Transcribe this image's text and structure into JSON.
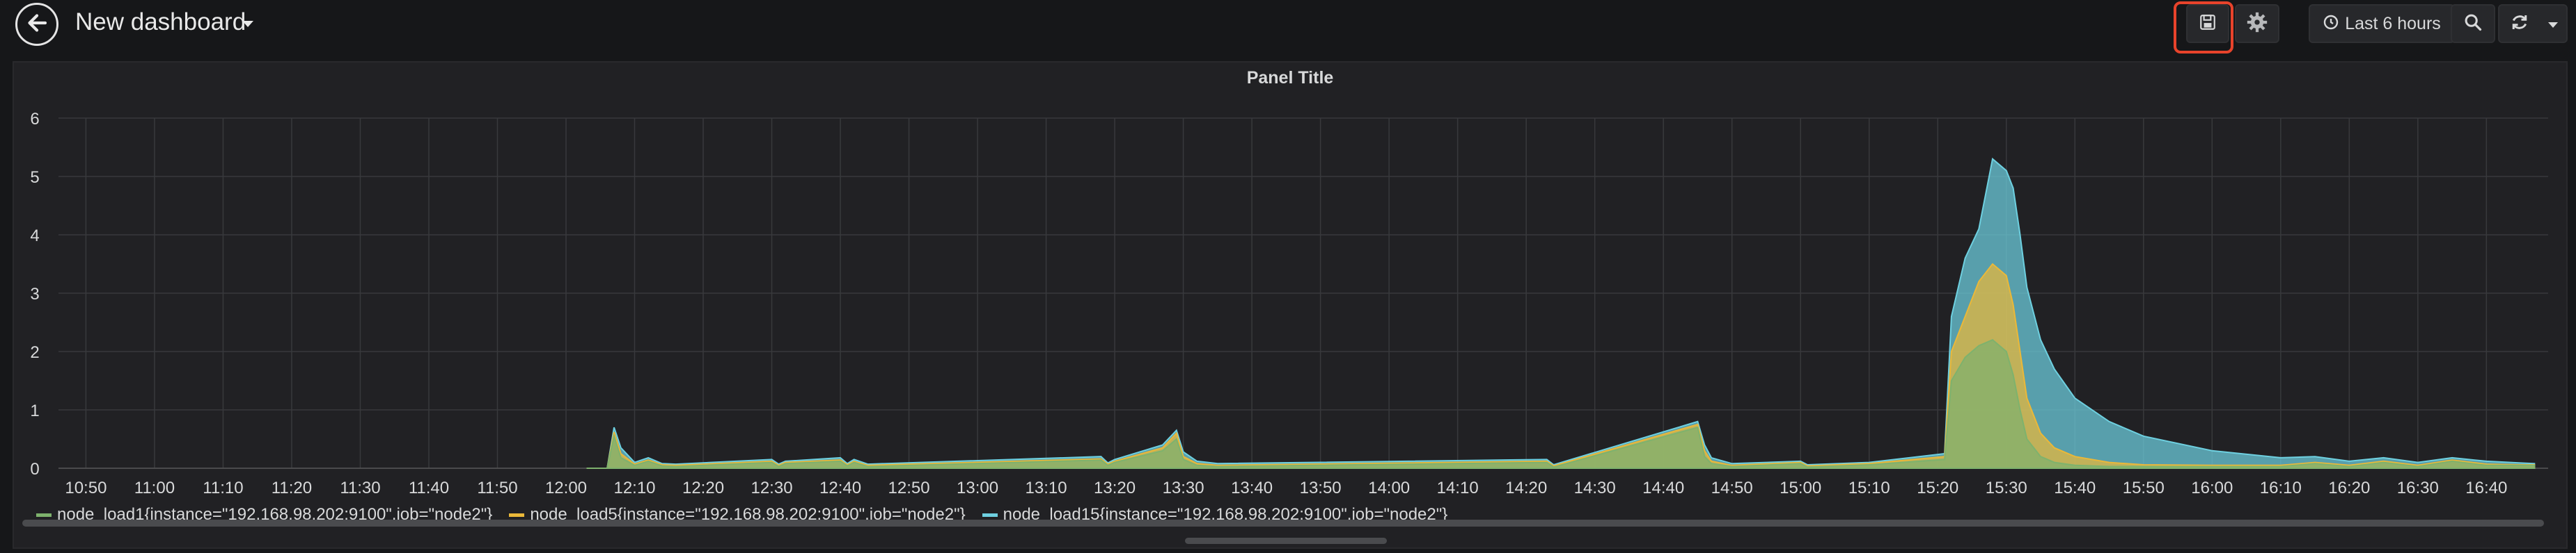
{
  "header": {
    "title": "New dashboard",
    "time_range_label": "Last 6 hours"
  },
  "annotation": {
    "save_text": "保存",
    "color": "#e8432b"
  },
  "panel": {
    "title": "Panel Title"
  },
  "legend": [
    {
      "name": "node_load1{instance=\"192.168.98.202:9100\",job=\"node2\"}",
      "color": "#7eb26d"
    },
    {
      "name": "node_load5{instance=\"192.168.98.202:9100\",job=\"node2\"}",
      "color": "#eab839"
    },
    {
      "name": "node_load15{instance=\"192.168.98.202:9100\",job=\"node2\"}",
      "color": "#6ed0e0"
    }
  ],
  "chart_data": {
    "type": "area",
    "title": "Panel Title",
    "x_ticks": [
      "10:50",
      "11:00",
      "11:10",
      "11:20",
      "11:30",
      "11:40",
      "11:50",
      "12:00",
      "12:10",
      "12:20",
      "12:30",
      "12:40",
      "12:50",
      "13:00",
      "13:10",
      "13:20",
      "13:30",
      "13:40",
      "13:50",
      "14:00",
      "14:10",
      "14:20",
      "14:30",
      "14:40",
      "14:50",
      "15:00",
      "15:10",
      "15:20",
      "15:30",
      "15:40",
      "15:50",
      "16:00",
      "16:10",
      "16:20",
      "16:30",
      "16:40"
    ],
    "y_ticks": [
      "0",
      "1",
      "2",
      "3",
      "4",
      "5",
      "6"
    ],
    "ylim": [
      0,
      6
    ],
    "xlim_minutes": [
      646,
      1009
    ],
    "x": [
      "12:03",
      "12:06",
      "12:07",
      "12:08",
      "12:10",
      "12:12",
      "12:14",
      "12:16",
      "12:30",
      "12:31",
      "12:32",
      "12:40",
      "12:41",
      "12:42",
      "12:44",
      "13:18",
      "13:19",
      "13:20",
      "13:27",
      "13:29",
      "13:30",
      "13:32",
      "13:35",
      "14:23",
      "14:24",
      "14:45",
      "14:46",
      "14:47",
      "14:50",
      "15:00",
      "15:01",
      "15:10",
      "15:21",
      "15:22",
      "15:24",
      "15:26",
      "15:28",
      "15:29",
      "15:30",
      "15:31",
      "15:32",
      "15:33",
      "15:35",
      "15:37",
      "15:40",
      "15:45",
      "15:50",
      "16:00",
      "16:10",
      "16:15",
      "16:20",
      "16:25",
      "16:30",
      "16:35",
      "16:40",
      "16:45",
      "16:47"
    ],
    "series": [
      {
        "name": "node_load1{instance=\"192.168.98.202:9100\",job=\"node2\"}",
        "values": [
          0.0,
          0.0,
          0.55,
          0.18,
          0.05,
          0.12,
          0.04,
          0.03,
          0.1,
          0.03,
          0.08,
          0.12,
          0.04,
          0.1,
          0.03,
          0.14,
          0.05,
          0.1,
          0.3,
          0.5,
          0.15,
          0.05,
          0.03,
          0.1,
          0.02,
          0.7,
          0.2,
          0.08,
          0.03,
          0.08,
          0.02,
          0.06,
          0.15,
          1.5,
          1.9,
          2.1,
          2.2,
          2.1,
          2.0,
          1.6,
          1.0,
          0.5,
          0.2,
          0.1,
          0.05,
          0.03,
          0.03,
          0.03,
          0.03,
          0.08,
          0.03,
          0.1,
          0.03,
          0.12,
          0.05,
          0.05,
          0.05
        ]
      },
      {
        "name": "node_load5{instance=\"192.168.98.202:9100\",job=\"node2\"}",
        "values": [
          0.0,
          0.0,
          0.62,
          0.25,
          0.07,
          0.14,
          0.06,
          0.05,
          0.12,
          0.05,
          0.1,
          0.14,
          0.06,
          0.12,
          0.05,
          0.16,
          0.07,
          0.12,
          0.35,
          0.6,
          0.2,
          0.08,
          0.05,
          0.12,
          0.04,
          0.75,
          0.3,
          0.12,
          0.05,
          0.1,
          0.04,
          0.08,
          0.2,
          2.0,
          2.6,
          3.2,
          3.5,
          3.4,
          3.3,
          2.8,
          2.0,
          1.2,
          0.6,
          0.35,
          0.2,
          0.1,
          0.06,
          0.05,
          0.05,
          0.1,
          0.05,
          0.12,
          0.05,
          0.14,
          0.07,
          0.06,
          0.06
        ]
      },
      {
        "name": "node_load15{instance=\"192.168.98.202:9100\",job=\"node2\"}",
        "values": [
          0.0,
          0.0,
          0.7,
          0.35,
          0.1,
          0.18,
          0.08,
          0.07,
          0.15,
          0.07,
          0.12,
          0.18,
          0.08,
          0.15,
          0.07,
          0.2,
          0.09,
          0.15,
          0.4,
          0.65,
          0.28,
          0.12,
          0.08,
          0.15,
          0.06,
          0.8,
          0.4,
          0.18,
          0.08,
          0.12,
          0.06,
          0.1,
          0.25,
          2.6,
          3.6,
          4.1,
          5.3,
          5.2,
          5.1,
          4.8,
          4.0,
          3.1,
          2.2,
          1.7,
          1.2,
          0.8,
          0.55,
          0.3,
          0.18,
          0.2,
          0.12,
          0.18,
          0.1,
          0.18,
          0.12,
          0.09,
          0.08
        ]
      }
    ]
  }
}
